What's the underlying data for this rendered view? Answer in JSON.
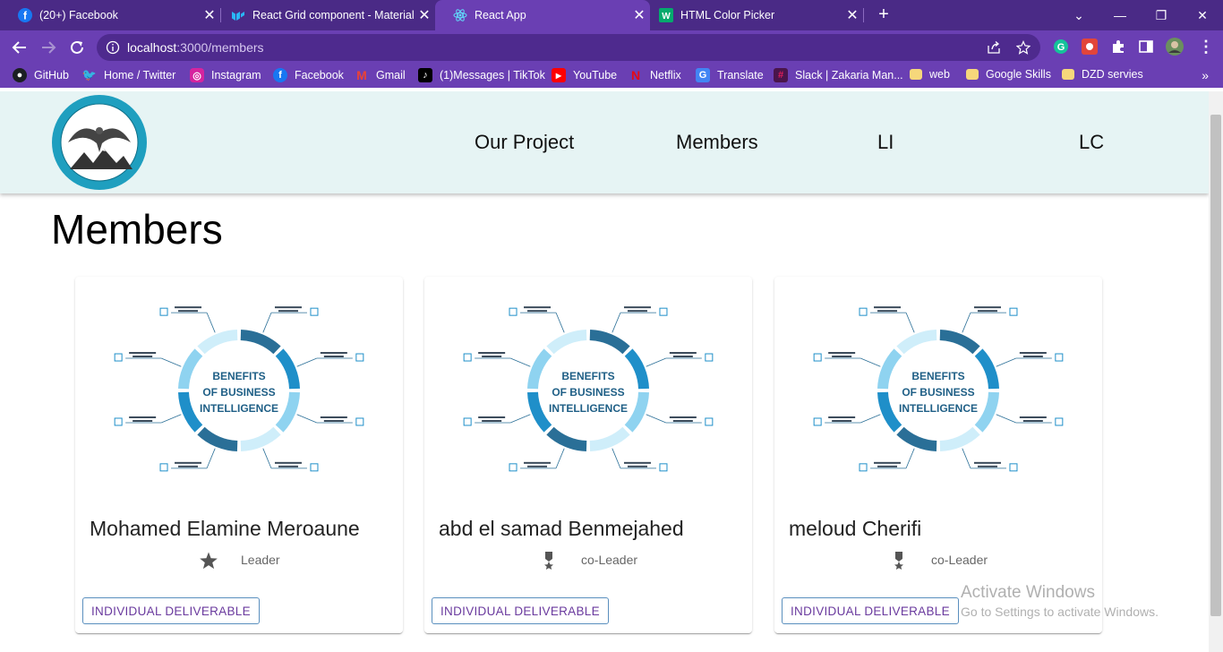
{
  "browser": {
    "tabs": [
      {
        "title": "(20+) Facebook",
        "icon": "facebook-icon"
      },
      {
        "title": "React Grid component - Material",
        "icon": "mui-icon"
      },
      {
        "title": "React App",
        "icon": "react-icon"
      },
      {
        "title": "HTML Color Picker",
        "icon": "w3schools-icon"
      }
    ],
    "url_host": "localhost",
    "url_path": ":3000/members",
    "bookmarks": [
      {
        "label": "GitHub",
        "icon": "github-icon"
      },
      {
        "label": "Home / Twitter",
        "icon": "twitter-icon"
      },
      {
        "label": "Instagram",
        "icon": "instagram-icon"
      },
      {
        "label": "Facebook",
        "icon": "facebook-icon"
      },
      {
        "label": "Gmail",
        "icon": "gmail-icon"
      },
      {
        "label": "(1)Messages | TikTok",
        "icon": "tiktok-icon"
      },
      {
        "label": "YouTube",
        "icon": "youtube-icon"
      },
      {
        "label": "Netflix",
        "icon": "netflix-icon"
      },
      {
        "label": "Translate",
        "icon": "translate-icon"
      },
      {
        "label": "Slack | Zakaria Man...",
        "icon": "slack-icon"
      },
      {
        "label": "web",
        "icon": "folder-icon"
      },
      {
        "label": "Google Skills",
        "icon": "folder-icon"
      },
      {
        "label": "DZD servies",
        "icon": "folder-icon"
      }
    ]
  },
  "colors": {
    "tabbar": "#4a2a86",
    "toolbar": "#6a3fb3",
    "appbar": "#e6f4f4",
    "button_text": "#6a3a9e",
    "infographic": "#1f8fc9"
  },
  "appbar": {
    "logo_alt": "eagle-logo",
    "nav": [
      "Our Project",
      "Members",
      "LI",
      "LC"
    ]
  },
  "page": {
    "title": "Members"
  },
  "infographic": {
    "center": [
      "BENEFITS",
      "OF BUSINESS",
      "INTELLIGENCE"
    ]
  },
  "members": [
    {
      "name": "Mohamed Elamine Meroaune",
      "role": "Leader",
      "role_icon": "star-icon",
      "button": "INDIVIDUAL DELIVERABLE"
    },
    {
      "name": "abd el samad Benmejahed",
      "role": "co-Leader",
      "role_icon": "medal-icon",
      "button": "INDIVIDUAL DELIVERABLE"
    },
    {
      "name": "meloud Cherifi",
      "role": "co-Leader",
      "role_icon": "medal-icon",
      "button": "INDIVIDUAL DELIVERABLE"
    }
  ],
  "watermark": {
    "line1": "Activate Windows",
    "line2": "Go to Settings to activate Windows."
  }
}
